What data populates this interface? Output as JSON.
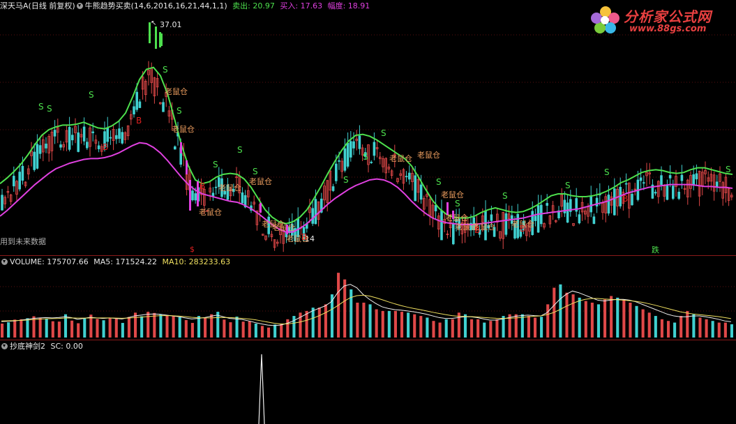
{
  "header": {
    "stock": "深天马A",
    "period": "(日线 前复权)",
    "indicator": "牛熊趋势买卖(14,6,2016,16,21,44,1,1)",
    "sell_label": "卖出: 20.97",
    "buy_label": "买入: 17.63",
    "range_label": "幅度: 18.91"
  },
  "logo": {
    "title": "分析家公式网",
    "url": "www.88gs.com"
  },
  "notes": {
    "future_data": "用到未来数据"
  },
  "volume_panel": {
    "title": "VOLUME: 175707.66",
    "ma5": "MA5: 171524.22",
    "ma10": "MA10: 283233.63"
  },
  "sc_panel": {
    "title": "抄底神剑2",
    "value": "SC: 0.00"
  },
  "colors": {
    "green": "#4de04d",
    "magenta": "#e040e0",
    "red": "#e02020",
    "orange": "#f0a060",
    "up": "#e04848",
    "down": "#40d0d0"
  },
  "chart_data": [
    {
      "type": "line",
      "title": "牛熊趋势买卖",
      "annotations": {
        "high_label": "37.01",
        "low_label": "14",
        "signal_laoshu": "老鼠仓",
        "signal_buy": "B",
        "signal_sell": "S",
        "signal_dollar": "$",
        "signal_die": "跌"
      },
      "x": [
        0,
        10,
        20,
        30,
        40,
        50,
        60,
        70,
        80,
        90,
        100,
        110,
        120,
        130,
        140,
        150,
        160,
        170,
        180,
        190,
        200,
        210,
        220,
        230,
        240,
        250,
        260,
        270,
        280,
        290,
        300,
        310,
        320,
        330,
        340,
        350,
        360,
        370,
        380,
        390,
        400,
        410,
        420,
        430,
        440,
        450,
        460,
        470,
        480,
        490,
        500,
        510,
        520,
        530,
        540,
        550,
        560,
        570,
        580,
        590,
        600,
        610,
        620,
        630,
        640,
        650,
        660,
        670,
        680,
        690,
        700,
        710,
        720,
        730,
        740,
        750,
        760,
        770,
        780,
        790,
        800,
        810,
        820,
        830,
        840,
        850,
        860,
        870,
        880,
        890,
        900,
        910,
        920,
        930,
        940,
        950,
        960,
        970,
        980,
        990,
        1000,
        1010,
        1020,
        1030,
        1040,
        1050
      ],
      "series": [
        {
          "values": [
            20.9,
            21.5,
            22.2,
            23.0,
            24.0,
            25.1,
            26.1,
            26.7,
            27.0,
            27.2,
            27.2,
            27.3,
            27.5,
            27.2,
            26.9,
            26.8,
            27.1,
            27.6,
            28.5,
            30.2,
            32.1,
            33.2,
            33.4,
            32.5,
            30.6,
            27.9,
            25.1,
            22.8,
            21.3,
            20.9,
            21.1,
            21.6,
            21.9,
            22.0,
            21.9,
            21.4,
            20.5,
            19.3,
            18.1,
            17.3,
            16.8,
            16.6,
            16.8,
            17.3,
            18.1,
            19.3,
            20.6,
            22.0,
            23.3,
            24.5,
            25.5,
            26.1,
            26.2,
            26.0,
            25.6,
            25.1,
            24.6,
            24.1,
            23.6,
            22.8,
            21.6,
            20.3,
            19.1,
            18.2,
            17.6,
            17.3,
            17.2,
            17.2,
            17.4,
            17.8,
            18.1,
            18.3,
            18.1,
            17.9,
            17.8,
            17.9,
            18.2,
            18.6,
            19.1,
            19.6,
            19.8,
            19.8,
            19.6,
            19.5,
            19.5,
            19.6,
            19.8,
            20.1,
            20.5,
            21.0,
            21.3,
            21.7,
            22.1,
            22.3,
            22.4,
            22.3,
            22.1,
            22.0,
            22.1,
            22.4,
            22.6,
            22.6,
            22.4,
            22.2,
            22.0,
            21.9
          ]
        },
        {
          "values": [
            17.4,
            18.0,
            18.7,
            19.4,
            20.1,
            20.8,
            21.4,
            22.0,
            22.5,
            22.8,
            23.1,
            23.3,
            23.5,
            23.6,
            23.6,
            23.7,
            23.9,
            24.2,
            24.6,
            25.0,
            25.3,
            25.2,
            24.8,
            24.2,
            23.4,
            22.5,
            21.6,
            20.8,
            20.2,
            19.8,
            19.6,
            19.4,
            19.2,
            19.0,
            18.9,
            18.6,
            18.2,
            17.7,
            17.1,
            16.5,
            16.0,
            15.7,
            15.7,
            16.1,
            16.6,
            17.3,
            18.0,
            18.7,
            19.3,
            19.8,
            20.3,
            20.7,
            21.0,
            21.3,
            21.4,
            21.3,
            21.0,
            20.5,
            19.8,
            19.0,
            18.3,
            17.7,
            17.2,
            16.9,
            16.7,
            16.6,
            16.5,
            16.5,
            16.5,
            16.6,
            16.7,
            16.8,
            16.9,
            17.0,
            17.1,
            17.2,
            17.4,
            17.6,
            17.7,
            17.8,
            17.9,
            18.0,
            18.1,
            18.2,
            18.4,
            18.6,
            18.8,
            19.0,
            19.3,
            19.6,
            19.9,
            20.1,
            20.3,
            20.5,
            20.6,
            20.7,
            20.8,
            20.8,
            20.8,
            20.8,
            20.7,
            20.6,
            20.6,
            20.5,
            20.5,
            20.4
          ]
        }
      ],
      "ylim": [
        13.5,
        39.0
      ]
    },
    {
      "type": "bar",
      "title": "VOLUME",
      "values": [
        84,
        92,
        108,
        110,
        116,
        128,
        118,
        112,
        98,
        96,
        140,
        102,
        86,
        118,
        138,
        112,
        104,
        118,
        116,
        88,
        124,
        150,
        128,
        155,
        148,
        140,
        132,
        130,
        122,
        105,
        88,
        130,
        118,
        140,
        155,
        108,
        92,
        126,
        96,
        98,
        84,
        70,
        60,
        78,
        80,
        110,
        130,
        150,
        160,
        180,
        180,
        200,
        260,
        390,
        350,
        290,
        210,
        210,
        200,
        170,
        160,
        160,
        160,
        155,
        150,
        140,
        130,
        120,
        100,
        90,
        110,
        110,
        150,
        140,
        110,
        110,
        90,
        100,
        110,
        130,
        140,
        140,
        140,
        130,
        120,
        125,
        200,
        300,
        320,
        270,
        260,
        240,
        220,
        210,
        200,
        230,
        250,
        240,
        230,
        210,
        190,
        170,
        150,
        130,
        110,
        100,
        90,
        130,
        160,
        140,
        120,
        110,
        100,
        90,
        90,
        80
      ],
      "ma5": [
        96,
        98,
        100,
        104,
        110,
        115,
        118,
        120,
        118,
        120,
        125,
        120,
        110,
        115,
        122,
        118,
        115,
        118,
        115,
        112,
        120,
        130,
        135,
        140,
        142,
        140,
        135,
        130,
        125,
        118,
        112,
        115,
        120,
        128,
        135,
        125,
        115,
        112,
        108,
        100,
        90,
        82,
        75,
        72,
        75,
        85,
        100,
        120,
        140,
        160,
        175,
        190,
        215,
        270,
        310,
        320,
        300,
        260,
        230,
        205,
        185,
        175,
        168,
        165,
        160,
        155,
        148,
        140,
        130,
        120,
        115,
        115,
        120,
        125,
        125,
        120,
        112,
        105,
        105,
        112,
        120,
        128,
        132,
        135,
        132,
        130,
        150,
        190,
        230,
        260,
        280,
        270,
        255,
        240,
        225,
        220,
        225,
        230,
        230,
        225,
        215,
        200,
        185,
        170,
        155,
        140,
        130,
        125,
        125,
        130,
        130,
        125,
        118,
        110,
        100,
        95
      ],
      "ma10": [
        100,
        101,
        102,
        103,
        105,
        108,
        111,
        113,
        114,
        115,
        117,
        118,
        117,
        117,
        118,
        118,
        118,
        118,
        117,
        116,
        117,
        120,
        123,
        126,
        129,
        132,
        132,
        131,
        129,
        126,
        122,
        119,
        118,
        118,
        120,
        121,
        120,
        118,
        115,
        112,
        107,
        100,
        93,
        86,
        82,
        82,
        86,
        93,
        103,
        115,
        130,
        148,
        168,
        192,
        218,
        240,
        252,
        255,
        250,
        240,
        228,
        215,
        203,
        192,
        183,
        175,
        168,
        160,
        152,
        145,
        138,
        132,
        128,
        127,
        126,
        124,
        121,
        118,
        116,
        115,
        116,
        118,
        121,
        125,
        128,
        130,
        138,
        150,
        168,
        188,
        205,
        220,
        230,
        235,
        235,
        232,
        230,
        228,
        225,
        222,
        218,
        212,
        204,
        195,
        185,
        175,
        165,
        155,
        148,
        142,
        138,
        134,
        130,
        126,
        120,
        114
      ],
      "ylim": [
        0,
        420
      ]
    },
    {
      "type": "bar",
      "title": "抄底神剑2",
      "categories": [
        "SC"
      ],
      "values": [
        0.0
      ]
    }
  ]
}
